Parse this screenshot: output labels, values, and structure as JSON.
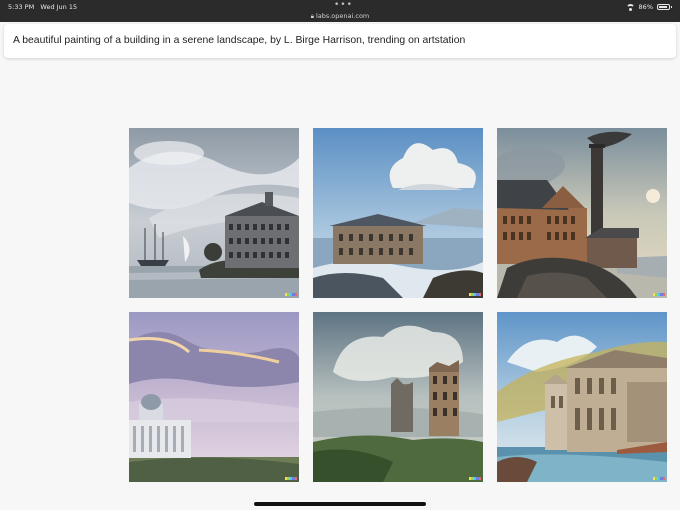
{
  "status_bar": {
    "time": "5:33 PM",
    "date": "Wed Jun 15",
    "dots": "•••",
    "url": "labs.openai.com",
    "battery": "86%",
    "battery_level": 0.86,
    "icons": [
      "lock-icon",
      "wifi-icon",
      "battery-icon"
    ]
  },
  "prompt": {
    "text": "A beautiful painting of a building in a serene landscape, by L. Birge Harrison, trending on artstation"
  },
  "watermark_colors": [
    "#f4e04d",
    "#8fd16a",
    "#57c3e6",
    "#6f7de0",
    "#e86b6b"
  ]
}
